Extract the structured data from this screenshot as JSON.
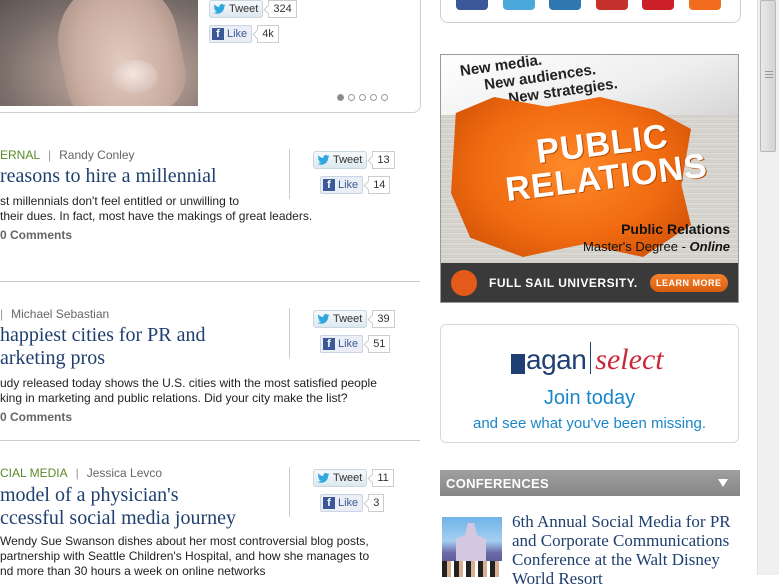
{
  "hero": {
    "tweet_label": "Tweet",
    "tweet_count": "324",
    "like_label": "Like",
    "like_count": "4k",
    "slides": 5,
    "active_slide": 0
  },
  "articles": [
    {
      "category": "ERNAL",
      "author": "Randy Conley",
      "headline": [
        " reasons to hire a millennial"
      ],
      "excerpt": [
        "st millennials don't feel entitled or unwilling to",
        " their dues. In fact, most have the makings of great leaders."
      ],
      "comments": "0 Comments",
      "tweet_label": "Tweet",
      "tweet_count": "13",
      "like_label": "Like",
      "like_count": "14"
    },
    {
      "category": "",
      "author": "Michael Sebastian",
      "headline": [
        " happiest cities for PR and",
        "arketing pros"
      ],
      "excerpt": [
        "udy released today shows the U.S. cities with the most satisfied people",
        "king in marketing and public relations. Did your city make the list?"
      ],
      "comments": "0 Comments",
      "tweet_label": "Tweet",
      "tweet_count": "39",
      "like_label": "Like",
      "like_count": "51"
    },
    {
      "category": "CIAL MEDIA",
      "author": "Jessica Levco",
      "headline": [
        "model of a physician's",
        "ccessful social media journey"
      ],
      "excerpt": [
        "Wendy Sue Swanson dishes about her most controversial blog posts,",
        "partnership with Seattle Children's Hospital, and how she manages to",
        "nd more than 30 hours a week on online networks"
      ],
      "comments": "",
      "tweet_label": "Tweet",
      "tweet_count": "11",
      "like_label": "Like",
      "like_count": "3"
    }
  ],
  "social_icons": [
    {
      "name": "facebook-icon",
      "color": "#3b5998"
    },
    {
      "name": "twitter-icon",
      "color": "#4aa8dc"
    },
    {
      "name": "linkedin-icon",
      "color": "#2f77b1"
    },
    {
      "name": "youtube-icon",
      "color": "#c4302b"
    },
    {
      "name": "pinterest-icon",
      "color": "#cb2027"
    },
    {
      "name": "rss-icon",
      "color": "#f26c1e"
    }
  ],
  "ad_pr": {
    "tagline": [
      "New media.",
      "New audiences.",
      "New strategies."
    ],
    "big": [
      "PUBLIC",
      "RELATIONS"
    ],
    "degree_line1": "Public Relations",
    "degree_line2": "Master's Degree - ",
    "degree_online": "Online",
    "school": "FULL SAIL UNIVERSITY.",
    "cta": "LEARN MORE"
  },
  "ragan": {
    "logo_word": "agan",
    "logo_select": "select",
    "join": "Join today",
    "sub": "and see what you've been missing."
  },
  "conferences": {
    "header": "CONFERENCES",
    "item_title": "6th Annual Social Media for PR and Corporate Communications Conference at the Walt Disney World Resort"
  },
  "colors": {
    "headline": "#1f3f6e",
    "category": "#5a8a2a",
    "ragan_blue": "#1a86c8",
    "ragan_red": "#c8283a"
  }
}
